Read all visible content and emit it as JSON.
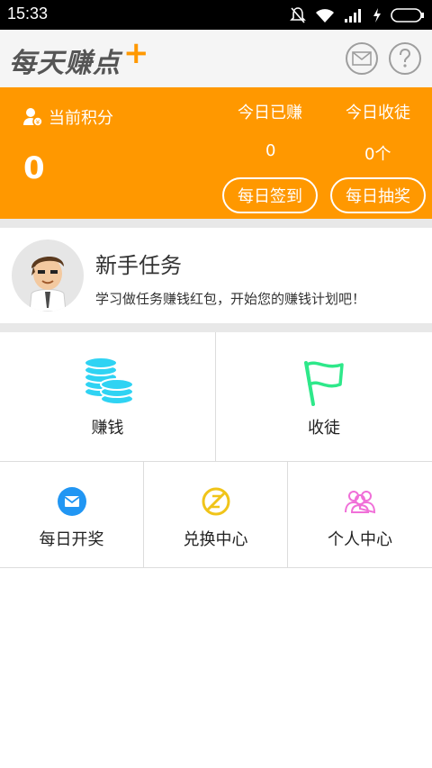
{
  "status_bar": {
    "time": "15:33"
  },
  "app": {
    "logo_text": "每天赚点",
    "logo_plus": "+"
  },
  "header_icons": {
    "mail": "mail-icon",
    "help": "help-icon"
  },
  "summary": {
    "points_label": "当前积分",
    "points_value": "0",
    "today_earned_label": "今日已赚",
    "today_earned_value": "0",
    "today_apprentices_label": "今日收徒",
    "today_apprentices_value": "0个",
    "checkin_button": "每日签到",
    "lottery_button": "每日抽奖"
  },
  "newbie_task": {
    "title": "新手任务",
    "description": "学习做任务赚钱红包，开始您的赚钱计划吧！"
  },
  "features": {
    "earn": "赚钱",
    "recruit": "收徒",
    "daily_draw": "每日开奖",
    "exchange": "兑换中心",
    "profile": "个人中心"
  },
  "colors": {
    "accent": "#ff9800",
    "coins": "#2fd3f3",
    "flag": "#2ee88a",
    "daily_draw": "#2196f3",
    "exchange": "#f0c419",
    "profile": "#f06fd8"
  }
}
